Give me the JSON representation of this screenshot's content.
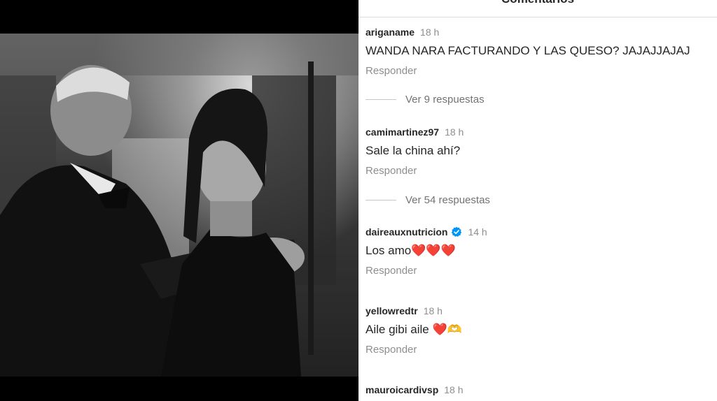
{
  "panel": {
    "title": "Comentarios"
  },
  "comments": [
    {
      "user": "ariganame",
      "time": "18 h",
      "verified": false,
      "text": "WANDA NARA FACTURANDO Y LAS QUESO? JAJAJJAJAJ",
      "reply_label": "Responder",
      "replies_label": "Ver 9 respuestas"
    },
    {
      "user": "camimartinez97",
      "time": "18 h",
      "verified": false,
      "text": "Sale la china ahí?",
      "reply_label": "Responder",
      "replies_label": "Ver 54 respuestas"
    },
    {
      "user": "daireauxnutricion",
      "time": "14 h",
      "verified": true,
      "text": "Los amo❤️❤️❤️",
      "reply_label": "Responder"
    },
    {
      "user": "yellowredtr",
      "time": "18 h",
      "verified": false,
      "text": "Aile gibi aile ❤️🫶",
      "reply_label": "Responder"
    },
    {
      "user": "mauroicardivsp",
      "time": "18 h",
      "verified": false
    }
  ],
  "colors": {
    "username": "#262626",
    "meta": "#8e8e8e",
    "verified": "#0095f6",
    "divider": "#dbdbdb"
  }
}
